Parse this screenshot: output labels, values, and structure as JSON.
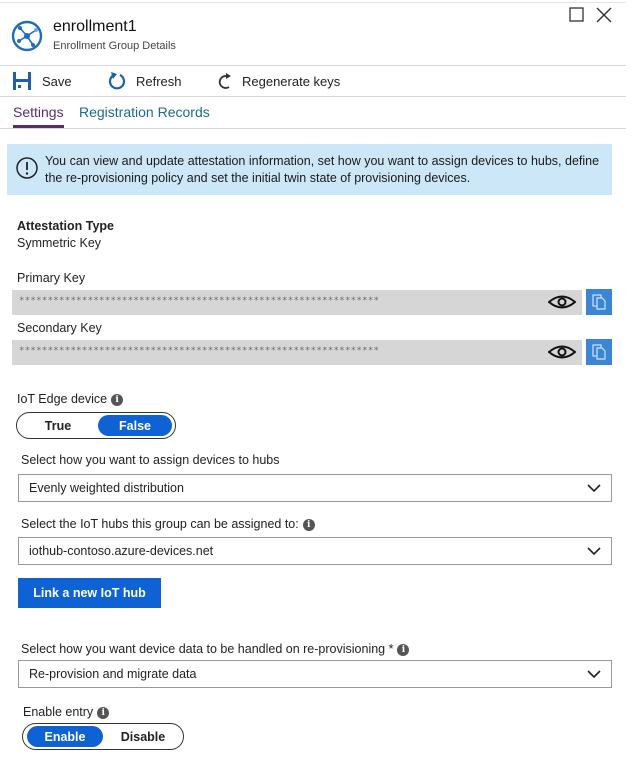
{
  "header": {
    "title": "enrollment1",
    "subtitle": "Enrollment Group Details"
  },
  "window_controls": {
    "maximize": "maximize-icon",
    "close": "close-icon"
  },
  "toolbar": {
    "save_label": "Save",
    "refresh_label": "Refresh",
    "regenerate_label": "Regenerate keys"
  },
  "tabs": [
    {
      "label": "Settings",
      "active": true
    },
    {
      "label": "Registration Records",
      "active": false
    }
  ],
  "info_banner": {
    "text": "You can view and update attestation information, set how you want to assign devices to hubs, define the re-provisioning policy and set the initial twin state of provisioning devices."
  },
  "attestation": {
    "label": "Attestation Type",
    "value": "Symmetric Key"
  },
  "primary_key": {
    "label": "Primary Key",
    "masked_value": "****************************************************************"
  },
  "secondary_key": {
    "label": "Secondary Key",
    "masked_value": "****************************************************************"
  },
  "iot_edge": {
    "label": "IoT Edge device",
    "options": [
      "True",
      "False"
    ],
    "selected": "False"
  },
  "assign_policy": {
    "label": "Select how you want to assign devices to hubs",
    "value": "Evenly weighted distribution"
  },
  "iot_hubs": {
    "label": "Select the IoT hubs this group can be assigned to:",
    "value": "iothub-contoso.azure-devices.net",
    "link_button": "Link a new IoT hub"
  },
  "reprovision": {
    "label": "Select how you want device data to be handled on re-provisioning *",
    "value": "Re-provision and migrate data"
  },
  "enable_entry": {
    "label": "Enable entry",
    "options": [
      "Enable",
      "Disable"
    ],
    "selected": "Enable"
  },
  "colors": {
    "accent": "#0f62d4",
    "tab_active": "#5c2d6e",
    "tab_link": "#1a6a8c",
    "info_bg": "#cce7f8",
    "copy_button": "#3a86d4"
  }
}
